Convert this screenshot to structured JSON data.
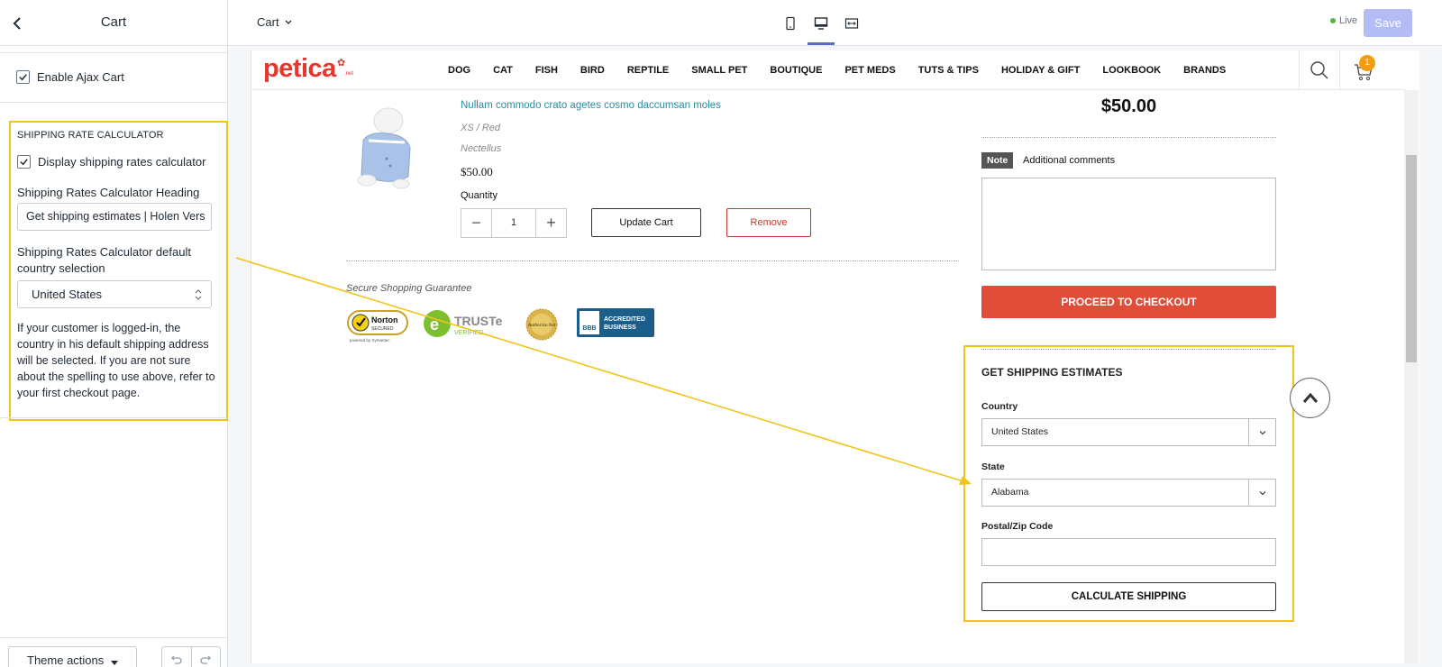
{
  "left_panel": {
    "title": "Cart",
    "enable_ajax_label": "Enable Ajax Cart",
    "shipping": {
      "heading": "SHIPPING RATE CALCULATOR",
      "display_label": "Display shipping rates calculator",
      "heading_field_label": "Shipping Rates Calculator Heading",
      "heading_field_value": "Get shipping estimates | Holen Vers",
      "country_label": "Shipping Rates Calculator default country selection",
      "country_value": "United States",
      "help_text": "If your customer is logged-in, the country in his default shipping address will be selected. If you are not sure about the spelling to use above, refer to your first checkout page."
    },
    "footer": {
      "theme_actions": "Theme actions"
    }
  },
  "topbar": {
    "page_select": "Cart",
    "live_label": "Live",
    "save_label": "Save"
  },
  "store": {
    "logo": "petica",
    "logo_sup": ".net",
    "nav": [
      "DOG",
      "CAT",
      "FISH",
      "BIRD",
      "REPTILE",
      "SMALL PET",
      "BOUTIQUE",
      "PET MEDS",
      "TUTS & TIPS",
      "HOLIDAY & GIFT",
      "LOOKBOOK",
      "BRANDS"
    ],
    "cart_count": "1",
    "product": {
      "title": "Nullam commodo crato agetes cosmo daccumsan moles",
      "variant": "XS / Red",
      "vendor": "Nectellus",
      "price": "$50.00",
      "quantity_label": "Quantity",
      "quantity_value": "1",
      "update_label": "Update Cart",
      "remove_label": "Remove"
    },
    "secure_label": "Secure Shopping Guarantee",
    "badges": {
      "norton": "Norton",
      "norton_sub": "SECURED",
      "norton_by": "powered by Symantec",
      "truste": "TRUSTe",
      "truste_sub": "VERIFIED",
      "authorize": "Authorize.Net",
      "bbb_line1": "ACCREDITED",
      "bbb_line2": "BUSINESS",
      "bbb_logo": "BBB"
    },
    "summary": {
      "total": "$50.00",
      "note_tag": "Note",
      "note_text": "Additional comments",
      "checkout_label": "PROCEED TO CHECKOUT"
    },
    "estimates": {
      "heading": "GET SHIPPING ESTIMATES",
      "country_label": "Country",
      "country_value": "United States",
      "state_label": "State",
      "state_value": "Alabama",
      "zip_label": "Postal/Zip Code",
      "calc_label": "CALCULATE SHIPPING"
    }
  },
  "colors": {
    "accent": "#5c6ac4",
    "highlight": "#f0c419",
    "checkout": "#e04e39",
    "brand": "#e8352e"
  }
}
